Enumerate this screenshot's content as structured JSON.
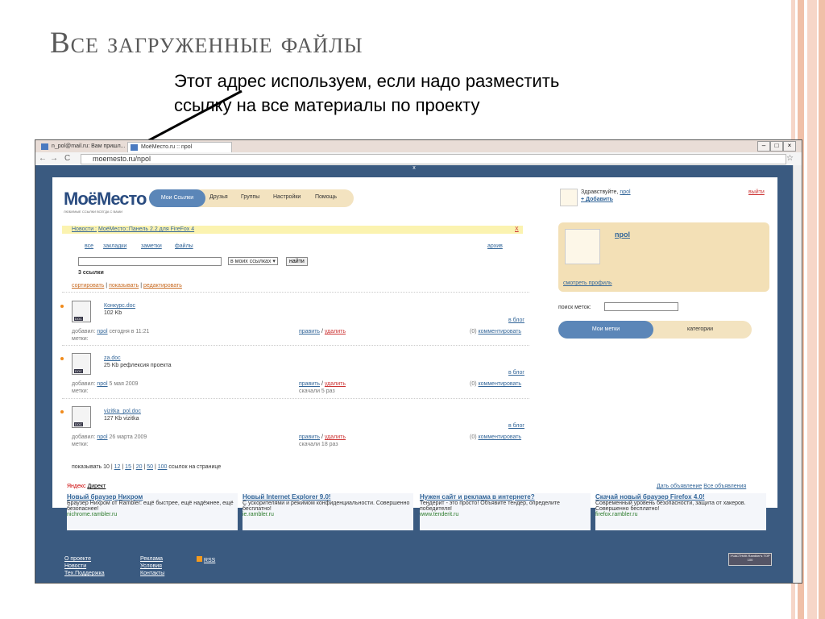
{
  "slide": {
    "title": "Все загруженные файлы",
    "caption_line1": "Этот адрес используем, если надо разместить",
    "caption_line2": "ссылку на все материалы по проекту"
  },
  "browser": {
    "tabs": [
      "n_pol@mail.ru: Вам пришл...",
      "МоёМесто.ru :: npol"
    ],
    "url": "moemesto.ru/npol",
    "close_bar": "x"
  },
  "site": {
    "logo": "МоёМесто",
    "logo_tagline": "ЛЮБИМЫЕ ССЫЛКИ ВСЕГДА С ВАМИ",
    "menu": [
      "Мои Ссылки",
      "Друзья",
      "Группы",
      "Настройки",
      "Помощь"
    ],
    "greeting": "Здравствуйте,",
    "user": "npol",
    "add_link": "+ Добавить",
    "logout": "выйти",
    "news_label": "Новости :",
    "news_text": "МоёМесто::Панель 2.2 для FireFox 4",
    "news_close": "X",
    "filters": [
      "все",
      "закладки",
      "заметки",
      "файлы"
    ],
    "archive": "архив",
    "scope": "в моих ссылках",
    "find_button": "найти",
    "count": "3 ссылки",
    "sort_links": [
      "сортировать",
      "показывать",
      "редактировать"
    ],
    "profile_name": "npol",
    "profile_link": "смотреть профиль",
    "tag_search_label": "поиск меток:",
    "tab_my_tags": "Мои метки",
    "tab_categories": "категории",
    "per_page_label": "показывать",
    "per_page_current": "10",
    "per_page_options": [
      "12",
      "15",
      "20",
      "50",
      "100"
    ],
    "per_page_suffix": "ссылок на странице"
  },
  "files": [
    {
      "name": "Конкурс.doc",
      "desc": "102 Kb",
      "added_by": "добавил:",
      "user": "npol",
      "date": "сегодня в 11:21",
      "tags": "метки:",
      "edit": "править",
      "delete": "удалить",
      "downloads": "",
      "comment_count": "(0)",
      "comment": "комментировать",
      "blog": "в блог"
    },
    {
      "name": "za.doc",
      "desc": "25 Kb рефлексия проекта",
      "added_by": "добавил:",
      "user": "npol",
      "date": "5 мая 2009",
      "tags": "метки:",
      "edit": "править",
      "delete": "удалить",
      "downloads": "скачали 5 раз",
      "comment_count": "(0)",
      "comment": "комментировать",
      "blog": "в блог"
    },
    {
      "name": "vizitka_pol.doc",
      "desc": "127 Kb vizitka",
      "added_by": "добавил:",
      "user": "npol",
      "date": "26 марта 2009",
      "tags": "метки:",
      "edit": "править",
      "delete": "удалить",
      "downloads": "скачали 18 раз",
      "comment_count": "(0)",
      "comment": "комментировать",
      "blog": "в блог"
    }
  ],
  "ads": {
    "brand": "Яндекс",
    "direct": "Директ",
    "give_ad": "Дать объявление",
    "all_ads": "Все объявления",
    "items": [
      {
        "title": "Новый браузер Нихром",
        "text": "Браузер Нихром от Rambler: ещё быстрее, ещё надёжнее, ещё безопаснее!",
        "url": "nichrome.rambler.ru"
      },
      {
        "title": "Новый Internet Explorer 9.0!",
        "text": "С ускорителями и режимом конфиденциальности. Совершенно бесплатно!",
        "url": "ie.rambler.ru"
      },
      {
        "title": "Нужен сайт и реклама в интернете?",
        "text": "Тендерит - это просто! Объявите тендер, определите победителя!",
        "url": "www.tenderit.ru"
      },
      {
        "title": "Скачай новый браузер Firefox 4.0!",
        "text": "Современный уровень безопасности, защита от хакеров. Совершенно бесплатно!",
        "url": "firefox.rambler.ru"
      }
    ]
  },
  "footer": {
    "col1": [
      "О проекте",
      "Новости",
      "Тех.Поддержка"
    ],
    "col2": [
      "Реклама",
      "Условия",
      "Контакты"
    ],
    "rss": "RSS",
    "badge": "УЧАСТНИК Rambler's TOP 100"
  }
}
